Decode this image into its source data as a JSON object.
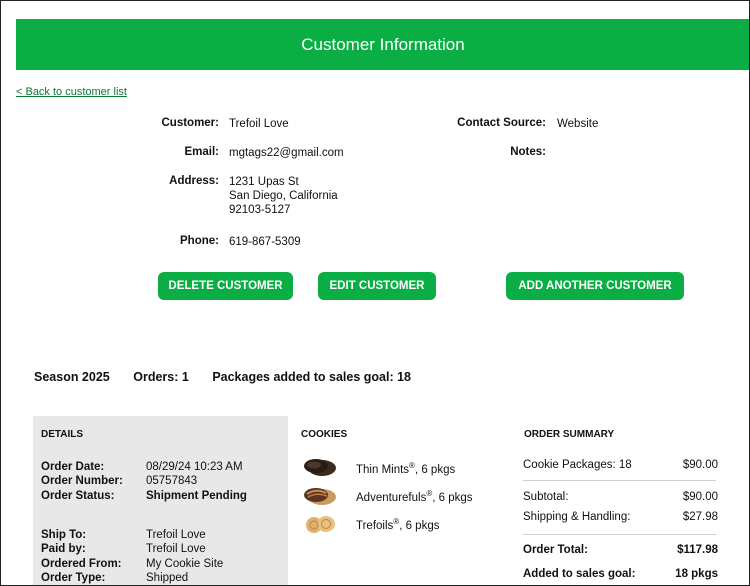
{
  "header": {
    "title": "Customer Information"
  },
  "nav": {
    "back_link": "< Back to customer list"
  },
  "customer": {
    "customer_label": "Customer:",
    "customer_value": "Trefoil Love",
    "email_label": "Email:",
    "email_value": "mgtags22@gmail.com",
    "address_label": "Address:",
    "address_line1": "1231 Upas St",
    "address_line2": "San Diego, California",
    "address_line3": "92103-5127",
    "phone_label": "Phone:",
    "phone_value": "619-867-5309",
    "contact_source_label": "Contact Source:",
    "contact_source_value": "Website",
    "notes_label": "Notes:"
  },
  "actions": {
    "delete": "DELETE CUSTOMER",
    "edit": "EDIT CUSTOMER",
    "add": "ADD ANOTHER CUSTOMER"
  },
  "season": {
    "season": "Season 2025",
    "orders": "Orders: 1",
    "packages": "Packages added to sales goal: 18"
  },
  "details": {
    "heading": "DETAILS",
    "order_date_label": "Order Date:",
    "order_date_value": "08/29/24 10:23 AM",
    "order_number_label": "Order Number:",
    "order_number_value": "05757843",
    "order_status_label": "Order Status:",
    "order_status_value": "Shipment Pending",
    "ship_to_label": "Ship To:",
    "ship_to_value": "Trefoil  Love",
    "paid_by_label": "Paid by:",
    "paid_by_value": "Trefoil  Love",
    "ordered_from_label": "Ordered From:",
    "ordered_from_value": "My Cookie Site",
    "order_type_label": "Order Type:",
    "order_type_value": "Shipped"
  },
  "cookies": {
    "heading": "COOKIES",
    "items": [
      {
        "name": "Thin Mints",
        "mark": "®",
        "qty": ", 6 pkgs",
        "icon": "thin-mints-cookie-icon"
      },
      {
        "name": "Adventurefuls",
        "mark": "®",
        "qty": ", 6 pkgs",
        "icon": "adventurefuls-cookie-icon"
      },
      {
        "name": "Trefoils",
        "mark": "®",
        "qty": ", 6 pkgs",
        "icon": "trefoils-cookie-icon"
      }
    ]
  },
  "summary": {
    "heading": "ORDER SUMMARY",
    "cookie_packages_label": "Cookie Packages: 18",
    "cookie_packages_value": "$90.00",
    "subtotal_label": "Subtotal:",
    "subtotal_value": "$90.00",
    "shipping_label": "Shipping & Handling:",
    "shipping_value": "$27.98",
    "total_label": "Order Total:",
    "total_value": "$117.98",
    "goal_label": "Added to sales goal:",
    "goal_value": "18 pkgs"
  },
  "colors": {
    "brand_green": "#0aae44",
    "link_green": "#0a7a33",
    "details_bg": "#e8e8e8"
  }
}
